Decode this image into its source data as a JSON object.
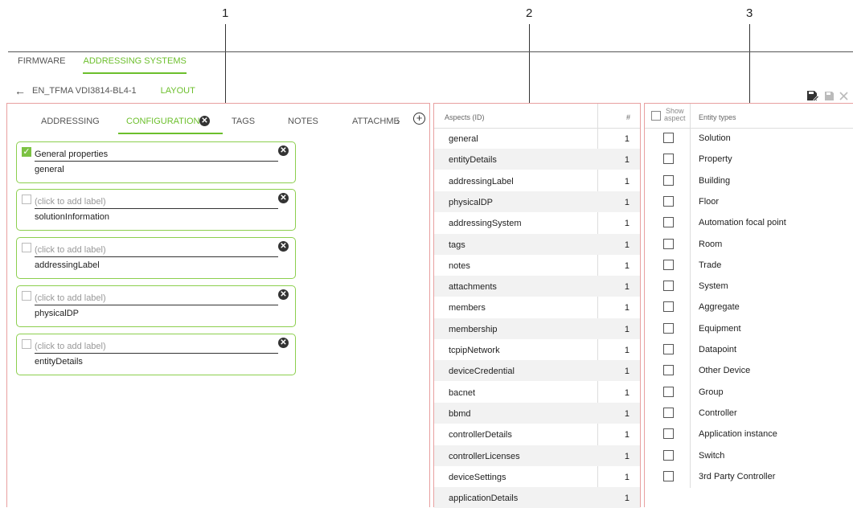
{
  "callouts": [
    "1",
    "2",
    "3"
  ],
  "nav": {
    "top_tabs": [
      "FIRMWARE",
      "ADDRESSING SYSTEMS"
    ],
    "breadcrumb": "EN_TFMA VDI3814-BL4-1",
    "layout_tab": "LAYOUT"
  },
  "toolbar": {
    "icons": [
      "save-edit-icon",
      "save-icon",
      "close-icon"
    ]
  },
  "config_panel": {
    "tabs": [
      "ADDRESSING",
      "CONFIGURATION",
      "TAGS",
      "NOTES",
      "ATTACHME"
    ],
    "active_tab": "CONFIGURATION",
    "cards": [
      {
        "label": "General properties",
        "key": "general",
        "checked": true
      },
      {
        "label": "(click to add label)",
        "key": "solutionInformation",
        "checked": false
      },
      {
        "label": "(click to add label)",
        "key": "addressingLabel",
        "checked": false
      },
      {
        "label": "(click to add label)",
        "key": "physicalDP",
        "checked": false
      },
      {
        "label": "(click to add label)",
        "key": "entityDetails",
        "checked": false
      }
    ]
  },
  "aspects_table": {
    "header_name": "Aspects (ID)",
    "header_count": "#",
    "rows": [
      {
        "name": "general",
        "count": "1"
      },
      {
        "name": "entityDetails",
        "count": "1"
      },
      {
        "name": "addressingLabel",
        "count": "1"
      },
      {
        "name": "physicalDP",
        "count": "1"
      },
      {
        "name": "addressingSystem",
        "count": "1"
      },
      {
        "name": "tags",
        "count": "1"
      },
      {
        "name": "notes",
        "count": "1"
      },
      {
        "name": "attachments",
        "count": "1"
      },
      {
        "name": "members",
        "count": "1"
      },
      {
        "name": "membership",
        "count": "1"
      },
      {
        "name": "tcpipNetwork",
        "count": "1"
      },
      {
        "name": "deviceCredential",
        "count": "1"
      },
      {
        "name": "bacnet",
        "count": "1"
      },
      {
        "name": "bbmd",
        "count": "1"
      },
      {
        "name": "controllerDetails",
        "count": "1"
      },
      {
        "name": "controllerLicenses",
        "count": "1"
      },
      {
        "name": "deviceSettings",
        "count": "1"
      },
      {
        "name": "applicationDetails",
        "count": "1"
      }
    ]
  },
  "entity_table": {
    "header_show_line1": "Show",
    "header_show_line2": "aspect",
    "header_name": "Entity types",
    "rows": [
      "Solution",
      "Property",
      "Building",
      "Floor",
      "Automation focal point",
      "Room",
      "Trade",
      "System",
      "Aggregate",
      "Equipment",
      "Datapoint",
      "Other Device",
      "Group",
      "Controller",
      "Application instance",
      "Switch",
      "3rd Party Controller"
    ]
  },
  "colors": {
    "accent": "#6cbf2c",
    "panel_border": "#e8a0a0",
    "card_border": "#8ccf4e"
  }
}
